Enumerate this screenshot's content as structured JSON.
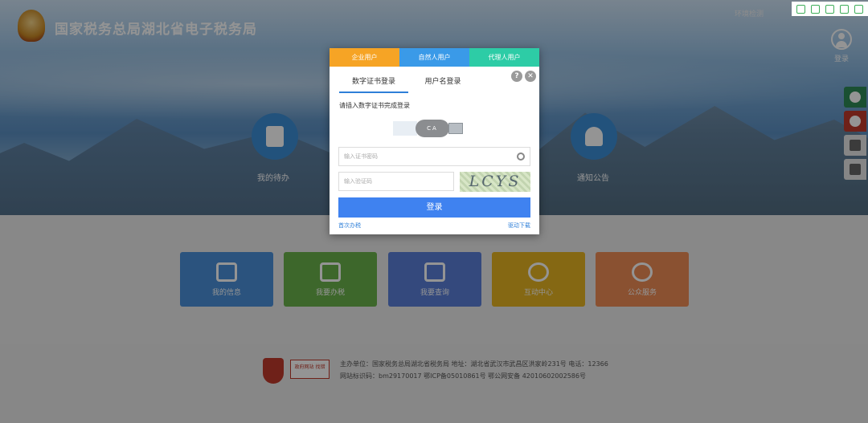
{
  "header": {
    "site_title": "国家税务总局湖北省电子税务局",
    "env_check": "环境检测",
    "login_label": "登录"
  },
  "banner": {
    "my_todo": "我的待办",
    "notice": "通知公告"
  },
  "tiles": [
    {
      "label": "我的信息",
      "color": "#4a90d9"
    },
    {
      "label": "我要办税",
      "color": "#6ab24a"
    },
    {
      "label": "我要查询",
      "color": "#5a7fd8"
    },
    {
      "label": "互动中心",
      "color": "#e6b322"
    },
    {
      "label": "公众服务",
      "color": "#ee8c55"
    }
  ],
  "footer": {
    "line1": "主办单位：国家税务总局湖北省税务局   地址：湖北省武汉市武昌区洪家岭231号  电话：12366",
    "line2": "网站标识码：bm29170017   鄂ICP备05010861号   鄂公网安备 42010602002586号",
    "badge_text": "政府网站 找错"
  },
  "modal": {
    "user_tabs": [
      "企业用户",
      "自然人用户",
      "代理人用户"
    ],
    "login_tabs": [
      "数字证书登录",
      "用户名登录"
    ],
    "hint": "请插入数字证书完成登录",
    "usb_label": "CA",
    "cert_password_placeholder": "输入证书密码",
    "captcha_placeholder": "输入验证码",
    "captcha_text": "LCYS",
    "login_button": "登录",
    "first_time_link": "首次办税",
    "driver_download_link": "驱动下载"
  }
}
